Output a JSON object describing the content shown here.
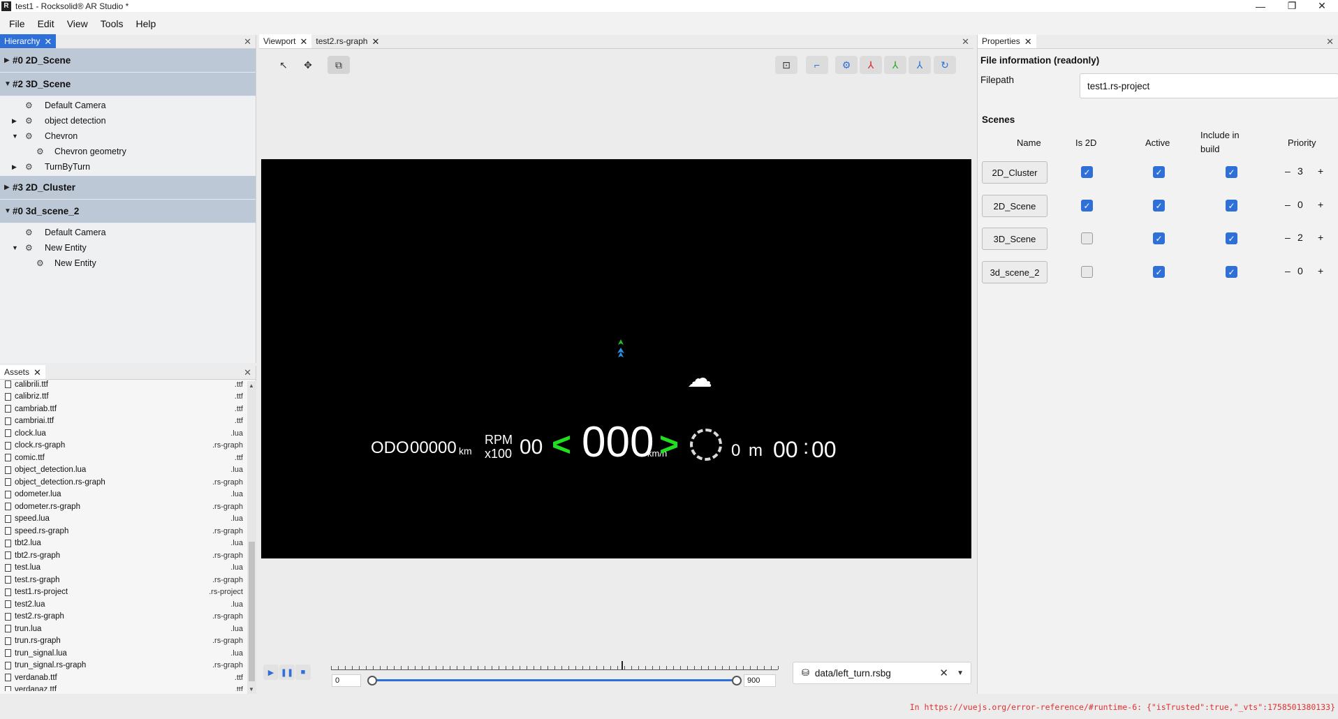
{
  "window": {
    "title": "test1 - Rocksolid® AR Studio *",
    "app_icon": "rocksolid-logo-icon",
    "minimize": "—",
    "restore": "❐",
    "close": "✕"
  },
  "menu": {
    "items": [
      "File",
      "Edit",
      "View",
      "Tools",
      "Help"
    ]
  },
  "hierarchy": {
    "tab_label": "Hierarchy",
    "scenes": [
      {
        "label": "#0 2D_Scene",
        "expanded": false
      },
      {
        "label": "#2 3D_Scene",
        "expanded": true
      },
      {
        "label": "#3 2D_Cluster",
        "expanded": false
      },
      {
        "label": "#0 3d_scene_2",
        "expanded": true
      }
    ],
    "scene2_entities": [
      {
        "label": "Default Camera",
        "has_children": false,
        "expanded": false,
        "depth": 0
      },
      {
        "label": "object detection",
        "has_children": true,
        "expanded": false,
        "depth": 0
      },
      {
        "label": "Chevron",
        "has_children": true,
        "expanded": true,
        "depth": 0
      },
      {
        "label": "Chevron geometry",
        "has_children": false,
        "expanded": false,
        "depth": 1
      },
      {
        "label": "TurnByTurn",
        "has_children": true,
        "expanded": false,
        "depth": 0
      }
    ],
    "scene4_entities": [
      {
        "label": "Default Camera",
        "has_children": false,
        "expanded": false,
        "depth": 0
      },
      {
        "label": "New Entity",
        "has_children": true,
        "expanded": true,
        "depth": 0
      },
      {
        "label": "New Entity",
        "has_children": false,
        "expanded": false,
        "depth": 1
      }
    ]
  },
  "assets": {
    "tab_label": "Assets",
    "files": [
      {
        "name": "calibrili.ttf",
        "ext": ".ttf"
      },
      {
        "name": "calibriz.ttf",
        "ext": ".ttf"
      },
      {
        "name": "cambriab.ttf",
        "ext": ".ttf"
      },
      {
        "name": "cambriai.ttf",
        "ext": ".ttf"
      },
      {
        "name": "clock.lua",
        "ext": ".lua"
      },
      {
        "name": "clock.rs-graph",
        "ext": ".rs-graph"
      },
      {
        "name": "comic.ttf",
        "ext": ".ttf"
      },
      {
        "name": "object_detection.lua",
        "ext": ".lua"
      },
      {
        "name": "object_detection.rs-graph",
        "ext": ".rs-graph"
      },
      {
        "name": "odometer.lua",
        "ext": ".lua"
      },
      {
        "name": "odometer.rs-graph",
        "ext": ".rs-graph"
      },
      {
        "name": "speed.lua",
        "ext": ".lua"
      },
      {
        "name": "speed.rs-graph",
        "ext": ".rs-graph"
      },
      {
        "name": "tbt2.lua",
        "ext": ".lua"
      },
      {
        "name": "tbt2.rs-graph",
        "ext": ".rs-graph"
      },
      {
        "name": "test.lua",
        "ext": ".lua"
      },
      {
        "name": "test.rs-graph",
        "ext": ".rs-graph"
      },
      {
        "name": "test1.rs-project",
        "ext": ".rs-project"
      },
      {
        "name": "test2.lua",
        "ext": ".lua"
      },
      {
        "name": "test2.rs-graph",
        "ext": ".rs-graph"
      },
      {
        "name": "trun.lua",
        "ext": ".lua"
      },
      {
        "name": "trun.rs-graph",
        "ext": ".rs-graph"
      },
      {
        "name": "trun_signal.lua",
        "ext": ".lua"
      },
      {
        "name": "trun_signal.rs-graph",
        "ext": ".rs-graph"
      },
      {
        "name": "verdanab.ttf",
        "ext": ".ttf"
      },
      {
        "name": "verdanaz.ttf",
        "ext": ".ttf"
      }
    ]
  },
  "viewport": {
    "tabs": [
      {
        "label": "Viewport",
        "active": true
      },
      {
        "label": "test2.rs-graph",
        "active": false
      }
    ],
    "left_tools": [
      {
        "icon": "pointer-icon",
        "glyph": "↖",
        "selected": false
      },
      {
        "icon": "move-icon",
        "glyph": "✥",
        "selected": false
      },
      {
        "icon": "scale-icon",
        "glyph": "⧉",
        "selected": true
      }
    ],
    "right_tools": [
      {
        "icon": "screen-fit-icon",
        "glyph": "⊡",
        "color": "#333333"
      },
      {
        "icon": "snap-icon",
        "glyph": "⌐",
        "color": "#2f6fd8"
      },
      {
        "icon": "settings-gizmo-icon",
        "glyph": "⚙",
        "color": "#2f6fd8"
      },
      {
        "icon": "axis-x-icon",
        "glyph": "⅄",
        "color": "#dd2222"
      },
      {
        "icon": "axis-y-icon",
        "glyph": "⅄",
        "color": "#22aa22"
      },
      {
        "icon": "axis-z-icon",
        "glyph": "⅄",
        "color": "#2f6fd8"
      },
      {
        "icon": "refresh-icon",
        "glyph": "↻",
        "color": "#2f6fd8"
      }
    ],
    "hud": {
      "odo_label": "ODO",
      "odo_value": "00000",
      "odo_unit": "km",
      "rpm_label": "RPM",
      "rpm_scale": "x100",
      "rpm_value": "00",
      "left_arrow": "<",
      "speed_value": "000",
      "speed_unit": "km/h",
      "right_arrow": ">",
      "distance_value": "0",
      "distance_unit": "m",
      "clock_hours": "00",
      "clock_sep": ":",
      "clock_minutes": "00"
    },
    "playback": {
      "play_icon": "▶",
      "pause_icon": "❚❚",
      "stop_icon": "■",
      "range_start": "0",
      "range_end": "900",
      "cursor_fraction": 0.65,
      "file_label": "data/left_turn.rsbg",
      "file_icon": "database-icon"
    }
  },
  "properties": {
    "tab_label": "Properties",
    "file_info_title": "File information (readonly)",
    "filepath_label": "Filepath",
    "filepath_value": "test1.rs-project",
    "scenes_title": "Scenes",
    "columns": {
      "name": "Name",
      "is2d": "Is 2D",
      "active": "Active",
      "include_line1": "Include in",
      "include_line2": "build",
      "priority": "Priority"
    },
    "scenes": [
      {
        "name": "2D_Cluster",
        "is2d": true,
        "active": true,
        "include": true,
        "priority": "3"
      },
      {
        "name": "2D_Scene",
        "is2d": true,
        "active": true,
        "include": true,
        "priority": "0"
      },
      {
        "name": "3D_Scene",
        "is2d": false,
        "active": true,
        "include": true,
        "priority": "2"
      },
      {
        "name": "3d_scene_2",
        "is2d": false,
        "active": true,
        "include": true,
        "priority": "0"
      }
    ],
    "minus": "–",
    "plus": "+"
  },
  "status": {
    "message": "In https://vuejs.org/error-reference/#runtime-6: {\"isTrusted\":true,\"_vts\":1758501380133}"
  }
}
